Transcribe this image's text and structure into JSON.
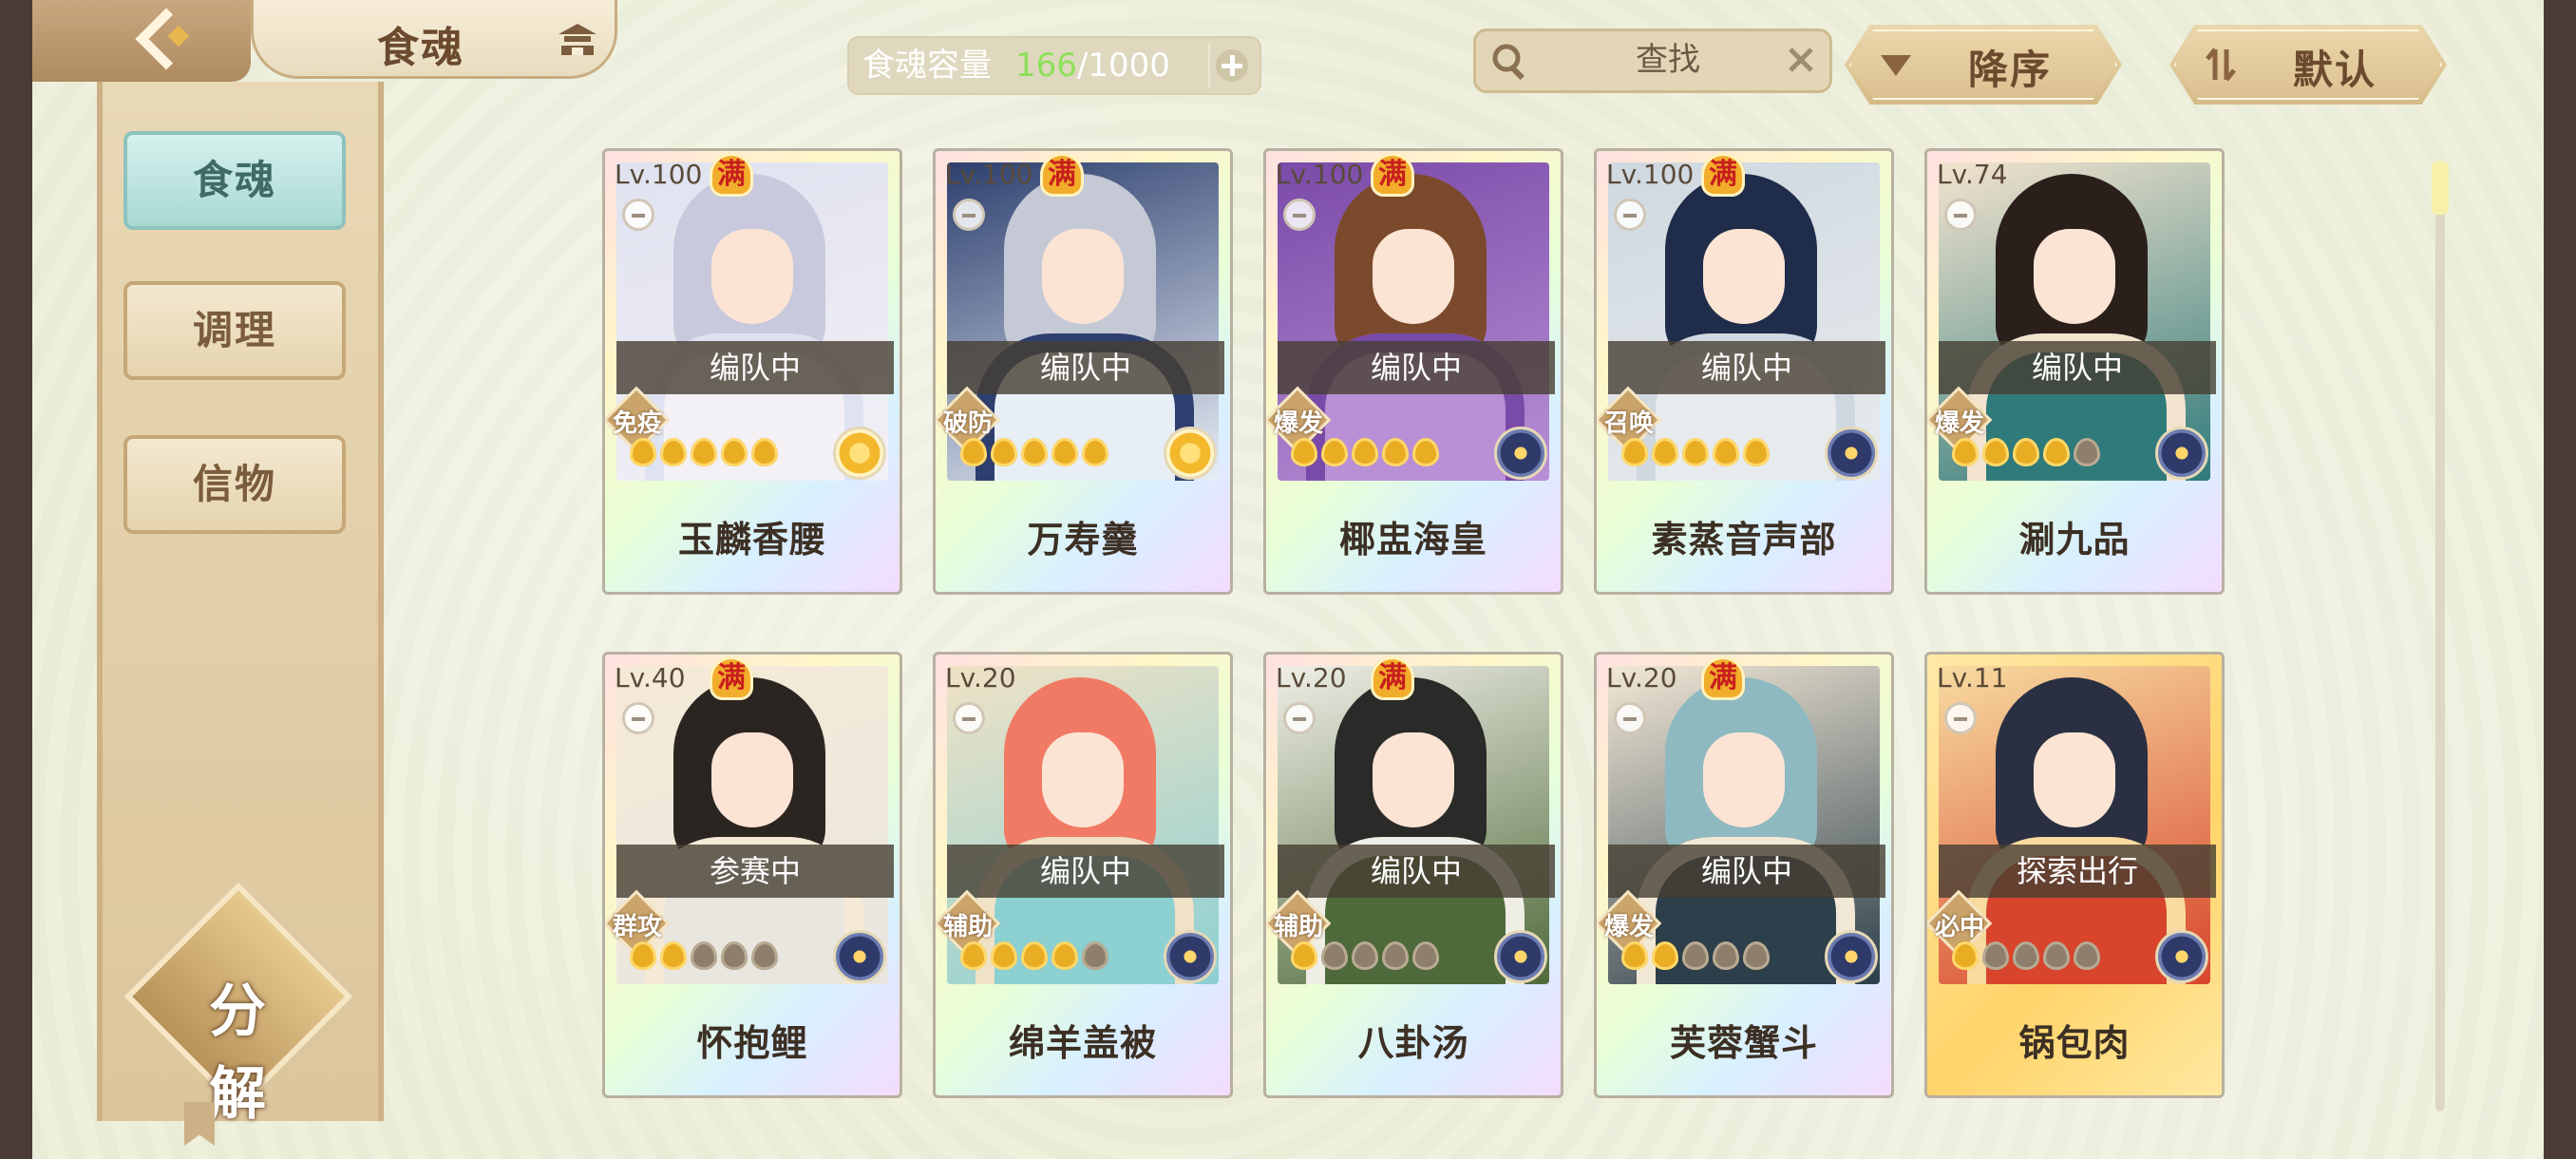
{
  "header": {
    "title": "食魂",
    "capacity_label": "食魂容量",
    "capacity_current": "166",
    "capacity_max": "/1000",
    "search_placeholder": "查找",
    "sort_order_label": "降序",
    "sort_mode_label": "默认"
  },
  "sidebar": {
    "tabs": [
      "食魂",
      "调理",
      "信物"
    ],
    "active_tab": 0,
    "decompose_label": "分解"
  },
  "cards": [
    {
      "level": "Lv.100",
      "max": "满",
      "status": "编队中",
      "role": "免疫",
      "name": "玉麟香腰",
      "stars_filled": 5,
      "element": "flower",
      "palette": [
        "#dfe2f0",
        "#c8c9dc",
        "#f3f0f6"
      ]
    },
    {
      "level": "Lv.100",
      "max": "满",
      "status": "编队中",
      "role": "破防",
      "name": "万寿羹",
      "stars_filled": 5,
      "element": "flower",
      "palette": [
        "#2c3f6e",
        "#c5c9d6",
        "#e8eef6"
      ]
    },
    {
      "level": "Lv.100",
      "max": "满",
      "status": "编队中",
      "role": "爆发",
      "name": "椰盅海皇",
      "stars_filled": 5,
      "element": "wheel",
      "palette": [
        "#7a4aa8",
        "#7b4a2c",
        "#b98fd6"
      ]
    },
    {
      "level": "Lv.100",
      "max": "满",
      "status": "编队中",
      "role": "召唤",
      "name": "素蒸音声部",
      "stars_filled": 5,
      "element": "wheel",
      "palette": [
        "#cfd8e0",
        "#1f2d4a",
        "#e8ebee"
      ]
    },
    {
      "level": "Lv.74",
      "max": "",
      "status": "编队中",
      "role": "爆发",
      "name": "涮九品",
      "stars_filled": 4,
      "element": "wheel",
      "palette": [
        "#f3e4cf",
        "#2b1f1c",
        "#2f7a7a"
      ]
    },
    {
      "level": "Lv.40",
      "max": "满",
      "status": "参赛中",
      "role": "群攻",
      "name": "怀抱鲤",
      "stars_filled": 2,
      "element": "wheel",
      "palette": [
        "#f5ead6",
        "#2b2522",
        "#e9e6e0"
      ]
    },
    {
      "level": "Lv.20",
      "max": "",
      "status": "编队中",
      "role": "辅助",
      "name": "绵羊盖被",
      "stars_filled": 4,
      "element": "wheel",
      "palette": [
        "#f0e2c6",
        "#f07a64",
        "#8cd0d2"
      ]
    },
    {
      "level": "Lv.20",
      "max": "满",
      "status": "编队中",
      "role": "辅助",
      "name": "八卦汤",
      "stars_filled": 1,
      "element": "wheel",
      "palette": [
        "#efeee6",
        "#2a2a28",
        "#4f6a3a"
      ]
    },
    {
      "level": "Lv.20",
      "max": "满",
      "status": "编队中",
      "role": "爆发",
      "name": "芙蓉蟹斗",
      "stars_filled": 2,
      "element": "wheel",
      "palette": [
        "#f2e8d6",
        "#8fb9c0",
        "#2c3f4a"
      ]
    },
    {
      "level": "Lv.11",
      "max": "",
      "status": "探索出行",
      "role": "必中",
      "name": "锅包肉",
      "stars_filled": 1,
      "element": "wheel",
      "palette": [
        "#f7dba0",
        "#2a3042",
        "#d8452c"
      ]
    }
  ],
  "icons": {
    "back": "back-arrow-icon",
    "home": "pavilion-icon",
    "add": "plus-icon",
    "search": "search-icon",
    "clear": "close-icon",
    "sort_desc": "down-triangle-icon",
    "sort_default": "swap-icon"
  },
  "colors": {
    "active_tab": "#a8d8d2",
    "capacity_current": "#8ee05a",
    "max_badge": "#f2ad2a"
  }
}
